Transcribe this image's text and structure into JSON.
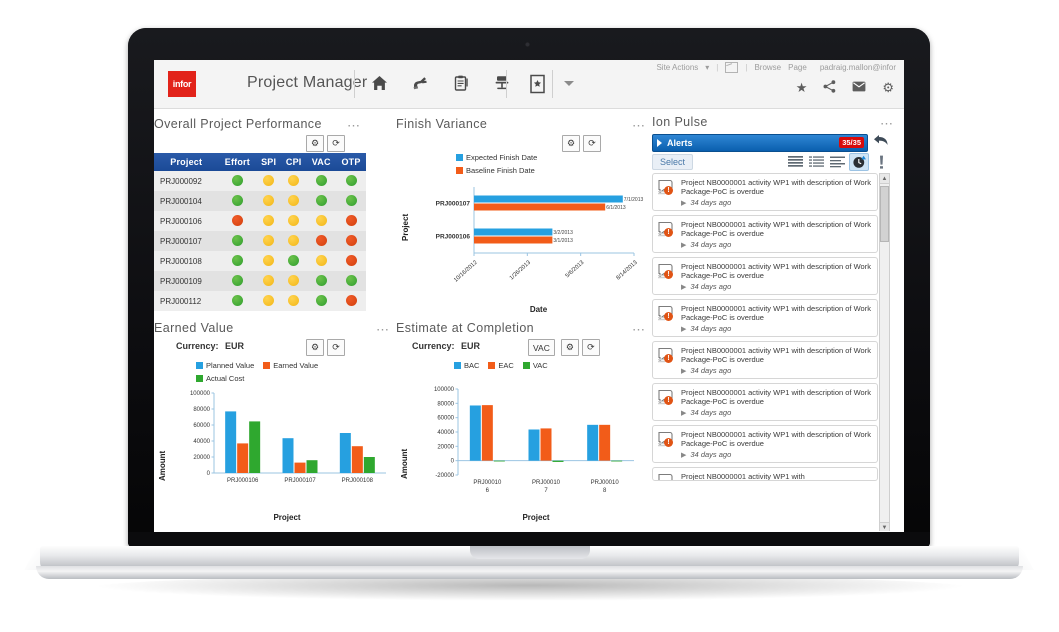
{
  "app": {
    "brand": "infor",
    "title": "Project Manager",
    "nav_icons": [
      "home-icon",
      "hand-pointer-icon",
      "clipboard-icon",
      "office-chair-icon"
    ],
    "doc_icon": "document-star-icon",
    "dropdown_caret": "chevron-down-icon"
  },
  "sitebar": {
    "site_actions": "Site Actions",
    "browse": "Browse",
    "page": "Page",
    "user": "padraig.mallon@infor",
    "icons": [
      "star-icon",
      "share-icon",
      "mail-icon",
      "gear-icon"
    ]
  },
  "panels": {
    "overall": {
      "title": "Overall Project Performance",
      "settings_label": "⚙",
      "refresh_label": "⟳",
      "columns": [
        "Project",
        "Effort",
        "SPI",
        "CPI",
        "VAC",
        "OTP"
      ],
      "rows": [
        {
          "project": "PRJ000092",
          "status": [
            "g",
            "y",
            "y",
            "g",
            "g"
          ]
        },
        {
          "project": "PRJ000104",
          "status": [
            "g",
            "y",
            "y",
            "g",
            "g"
          ]
        },
        {
          "project": "PRJ000106",
          "status": [
            "r",
            "y",
            "y",
            "y",
            "r"
          ]
        },
        {
          "project": "PRJ000107",
          "status": [
            "g",
            "y",
            "y",
            "r",
            "r"
          ]
        },
        {
          "project": "PRJ000108",
          "status": [
            "g",
            "y",
            "g",
            "y",
            "r"
          ]
        },
        {
          "project": "PRJ000109",
          "status": [
            "g",
            "y",
            "y",
            "g",
            "g"
          ]
        },
        {
          "project": "PRJ000112",
          "status": [
            "g",
            "y",
            "y",
            "g",
            "r"
          ]
        }
      ]
    },
    "finish_variance": {
      "title": "Finish Variance",
      "settings_label": "⚙",
      "refresh_label": "⟳"
    },
    "earned_value": {
      "title": "Earned Value",
      "currency_label": "Currency:",
      "currency_value": "EUR",
      "settings_label": "⚙",
      "refresh_label": "⟳"
    },
    "estimate_at_completion": {
      "title": "Estimate at Completion",
      "currency_label": "Currency:",
      "currency_value": "EUR",
      "vac_button": "VAC",
      "settings_label": "⚙",
      "refresh_label": "⟳"
    },
    "ion_pulse": {
      "title": "Ion Pulse",
      "alerts_label": "Alerts",
      "alerts_badge": "35/35",
      "undo_icon": "undo-arrow-icon",
      "select_label": "Select",
      "view_icons": [
        "list-view-icon",
        "detail-view-icon",
        "compact-view-icon",
        "clock-icon",
        "exclamation-icon"
      ],
      "alerts": [
        {
          "text": "Project NB0000001 activity WP1 with description of Work Package-PoC is overdue",
          "time": "34 days ago"
        },
        {
          "text": "Project NB0000001 activity WP1 with description of Work Package-PoC is overdue",
          "time": "34 days ago"
        },
        {
          "text": "Project NB0000001 activity WP1 with description of Work Package-PoC is overdue",
          "time": "34 days ago"
        },
        {
          "text": "Project NB0000001 activity WP1 with description of Work Package-PoC is overdue",
          "time": "34 days ago"
        },
        {
          "text": "Project NB0000001 activity WP1 with description of Work Package-PoC is overdue",
          "time": "34 days ago"
        },
        {
          "text": "Project NB0000001 activity WP1 with description of Work Package-PoC is overdue",
          "time": "34 days ago"
        },
        {
          "text": "Project NB0000001 activity WP1 with description of Work Package-PoC is overdue",
          "time": "34 days ago"
        },
        {
          "text": "Project NB0000001 activity WP1 with",
          "time": ""
        }
      ]
    }
  },
  "colors": {
    "blue": "#26a0e0",
    "orange": "#f25c19",
    "green": "#2fa82f",
    "green_dot": "#4caf3f",
    "yellow_dot": "#ffc61e",
    "red_dot": "#e5400d",
    "brand_red": "#e2231a",
    "header_blue": "#1b4a97"
  },
  "chart_data": [
    {
      "id": "finish-variance",
      "type": "bar",
      "orientation": "horizontal",
      "title": "Finish Variance",
      "xlabel": "Date",
      "ylabel": "Project",
      "categories": [
        "PRJ000107",
        "PRJ000106"
      ],
      "xticks": [
        "10/16/2012",
        "1/26/2013",
        "5/6/2013",
        "8/14/2013"
      ],
      "legend": [
        "Expected Finish Date",
        "Baseline Finish Date"
      ],
      "legend_position": "top",
      "series": [
        {
          "name": "Expected Finish Date",
          "color": "#26a0e0",
          "values": [
            "7/1/2013",
            "3/2/2013"
          ],
          "bar_fraction": [
            0.93,
            0.49
          ]
        },
        {
          "name": "Baseline Finish Date",
          "color": "#f25c19",
          "values": [
            "6/1/2013",
            "3/1/2013"
          ],
          "bar_fraction": [
            0.82,
            0.49
          ]
        }
      ],
      "point_labels": [
        [
          "7/1/2013",
          "6/1/2013"
        ],
        [
          "3/2/2013",
          "3/1/2013"
        ]
      ]
    },
    {
      "id": "earned-value",
      "type": "bar",
      "title": "Earned Value",
      "xlabel": "Project",
      "ylabel": "Amount",
      "categories": [
        "PRJ000106",
        "PRJ000107",
        "PRJ000108"
      ],
      "yticks": [
        0,
        20000,
        40000,
        60000,
        80000,
        100000
      ],
      "ylim": [
        0,
        100000
      ],
      "legend": [
        "Planned Value",
        "Earned Value",
        "Actual Cost"
      ],
      "legend_position": "top",
      "series": [
        {
          "name": "Planned Value",
          "color": "#26a0e0",
          "values": [
            77000,
            43500,
            50000
          ]
        },
        {
          "name": "Earned Value",
          "color": "#f25c19",
          "values": [
            37000,
            13000,
            33500
          ]
        },
        {
          "name": "Actual Cost",
          "color": "#2fa82f",
          "values": [
            64500,
            16000,
            20000
          ]
        }
      ]
    },
    {
      "id": "estimate-at-completion",
      "type": "bar",
      "title": "Estimate at Completion",
      "xlabel": "Project",
      "ylabel": "Amount",
      "categories": [
        "PRJ00010 6",
        "PRJ00010 7",
        "PRJ00010 8"
      ],
      "yticks": [
        -20000,
        0,
        20000,
        40000,
        60000,
        80000,
        100000
      ],
      "ylim": [
        -20000,
        100000
      ],
      "legend": [
        "BAC",
        "EAC",
        "VAC"
      ],
      "legend_position": "top",
      "series": [
        {
          "name": "BAC",
          "color": "#26a0e0",
          "values": [
            77000,
            43500,
            50000
          ]
        },
        {
          "name": "EAC",
          "color": "#f25c19",
          "values": [
            77500,
            45000,
            50000
          ]
        },
        {
          "name": "VAC",
          "color": "#2fa82f",
          "values": [
            -600,
            -1800,
            0
          ]
        }
      ]
    }
  ]
}
